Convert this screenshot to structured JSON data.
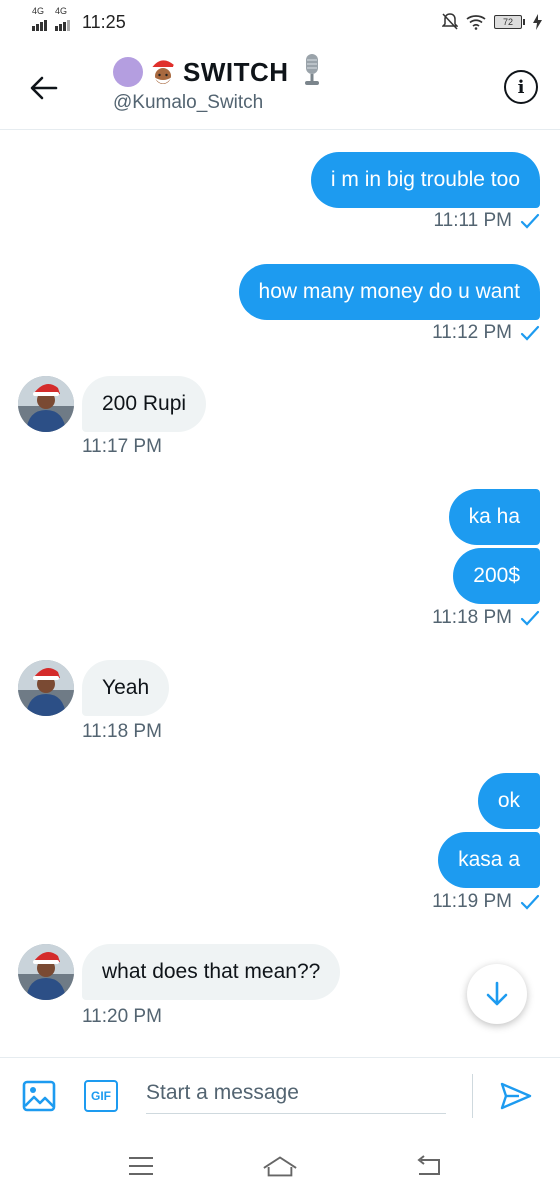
{
  "status_bar": {
    "net1": "4G",
    "net2": "4G",
    "time": "11:25",
    "battery": "72"
  },
  "header": {
    "title": "SWITCH",
    "handle": "@Kumalo_Switch",
    "back_icon": "arrow-left-icon",
    "info_icon": "info-icon"
  },
  "messages": [
    {
      "side": "sent",
      "text": "i m in big trouble too",
      "time": "11:11 PM"
    },
    {
      "side": "sent",
      "text": "how many money do u want",
      "time": "11:12 PM"
    },
    {
      "side": "received",
      "text": "200 Rupi",
      "time": "11:17 PM"
    },
    {
      "side": "sent",
      "text": "ka ha"
    },
    {
      "side": "sent",
      "text": "200$",
      "time": "11:18 PM"
    },
    {
      "side": "received",
      "text": "Yeah",
      "time": "11:18 PM"
    },
    {
      "side": "sent",
      "text": "ok"
    },
    {
      "side": "sent",
      "text": "kasa a",
      "time": "11:19 PM"
    },
    {
      "side": "received",
      "text": "what does that mean??",
      "time": "11:20 PM"
    }
  ],
  "composer": {
    "placeholder": "Start a message",
    "media_icon": "image-icon",
    "gif_label": "GIF",
    "send_icon": "send-icon"
  },
  "colors": {
    "accent": "#1d9bf0",
    "received_bubble": "#eff3f4",
    "muted_text": "#536471"
  }
}
